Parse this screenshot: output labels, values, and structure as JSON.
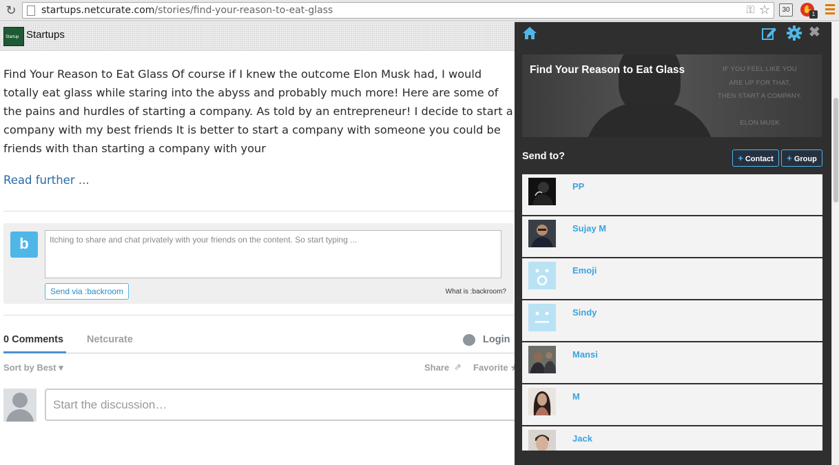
{
  "browser": {
    "url_host": "startups.netcurate.com",
    "url_path": "/stories/find-your-reason-to-eat-glass",
    "ext_count": "30",
    "ext_badge": "1",
    "icons": [
      "reload-icon",
      "page-icon",
      "key-icon",
      "star-icon",
      "calendar-extension-icon",
      "stop-extension-icon",
      "menu-icon"
    ]
  },
  "header": {
    "brand": "Startups",
    "logo_text": "Startup"
  },
  "article": {
    "body": "Find Your Reason to Eat Glass Of course if I knew the outcome Elon Musk had, I would totally eat glass while staring into the abyss and probably much more! Here are some of the pains and hurdles of starting a company. As told by an entrepreneur! I decide to start a company with my best friends It is better to start a company with someone you could be friends with than starting a company with your",
    "read_more": "Read further ..."
  },
  "backroom": {
    "logo": "b",
    "placeholder": "Itching to share and chat privately with your friends on the content. So start typing ...",
    "send_label": "Send via :backroom",
    "what_is": "What is :backroom?"
  },
  "comments": {
    "tab_comments": "0 Comments",
    "tab_site": "Netcurate",
    "login": "Login",
    "sort": "Sort by Best",
    "share": "Share",
    "favorite": "Favorite",
    "discussion_placeholder": "Start the discussion…"
  },
  "panel": {
    "story_title": "Find Your Reason to Eat Glass",
    "quote_lines": [
      "IF YOU FEEL LIKE YOU",
      "ARE UP FOR THAT,",
      "THEN START A COMPANY.",
      "",
      "ELON MUSK"
    ],
    "send_to": "Send to?",
    "contact_btn": "Contact",
    "group_btn": "Group",
    "contacts": [
      {
        "name": "PP"
      },
      {
        "name": "Sujay M"
      },
      {
        "name": "Emoji"
      },
      {
        "name": "Sindy"
      },
      {
        "name": "Mansi"
      },
      {
        "name": "M"
      },
      {
        "name": "Jack"
      }
    ]
  },
  "colors": {
    "accent": "#4fb7e8",
    "panel_bg": "#2f2f2f",
    "link": "#2a6aa5"
  }
}
